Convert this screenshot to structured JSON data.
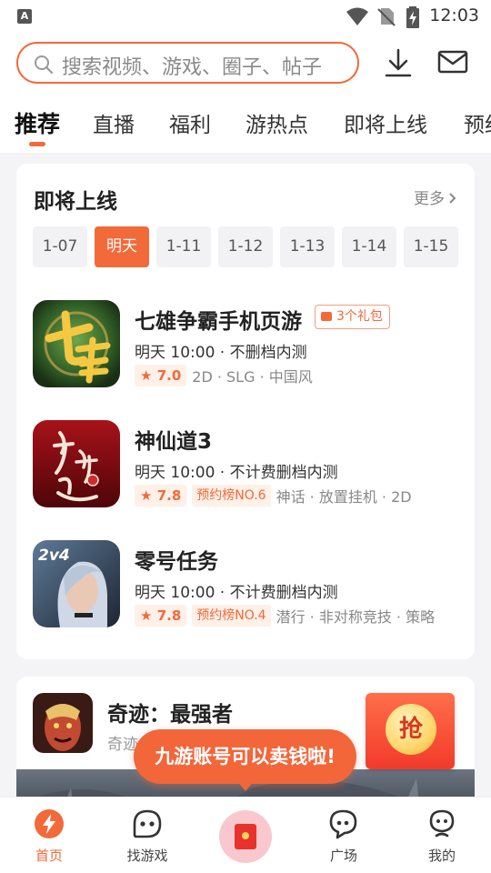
{
  "status_bar": {
    "time": "12:03",
    "notification_badge": "A"
  },
  "header": {
    "search_placeholder": "搜索视频、游戏、圈子、帖子"
  },
  "tabs": [
    {
      "label": "推荐",
      "active": true
    },
    {
      "label": "直播"
    },
    {
      "label": "福利"
    },
    {
      "label": "游热点"
    },
    {
      "label": "即将上线"
    },
    {
      "label": "预约"
    }
  ],
  "upcoming": {
    "title": "即将上线",
    "more": "更多",
    "dates": [
      "1-07",
      "明天",
      "1-11",
      "1-12",
      "1-13",
      "1-14",
      "1-15"
    ],
    "selected_date": "明天",
    "games": [
      {
        "name": "七雄争霸手机页游",
        "gift": "3个礼包",
        "time": "明天 10:00 · 不删档内测",
        "rating": "7.0",
        "rank": "",
        "tags": "2D · SLG · 中国风"
      },
      {
        "name": "神仙道3",
        "gift": "",
        "time": "明天 10:00 · 不计费删档内测",
        "rating": "7.8",
        "rank": "预约榜NO.6",
        "tags": "神话 · 放置挂机 · 2D"
      },
      {
        "name": "零号任务",
        "gift": "",
        "time": "明天 10:00 · 不计费删档内测",
        "rating": "7.8",
        "rank": "预约榜NO.4",
        "tags": "潜行 · 非对称竞技 · 策略"
      }
    ]
  },
  "featured": {
    "name": "奇迹：最强者",
    "sub": "奇迹",
    "redpack_label": "抢"
  },
  "toast": "九游账号可以卖钱啦!",
  "bottom_nav": [
    {
      "label": "首页",
      "active": true
    },
    {
      "label": "找游戏"
    },
    {
      "label": ""
    },
    {
      "label": "广场"
    },
    {
      "label": "我的"
    }
  ],
  "colors": {
    "accent": "#f26a3a",
    "background": "#f4f4f6"
  }
}
